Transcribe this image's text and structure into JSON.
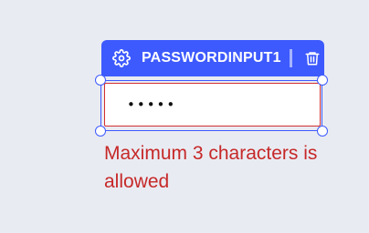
{
  "widget": {
    "name": "PASSWORDINPUT1",
    "settings_icon": "gear-icon",
    "delete_icon": "trash-icon"
  },
  "input": {
    "value": "•••••",
    "type": "password"
  },
  "validation": {
    "error_message": "Maximum 3 characters is allowed"
  },
  "colors": {
    "accent": "#3d5afe",
    "error": "#c62828",
    "background": "#e9ebf2"
  }
}
